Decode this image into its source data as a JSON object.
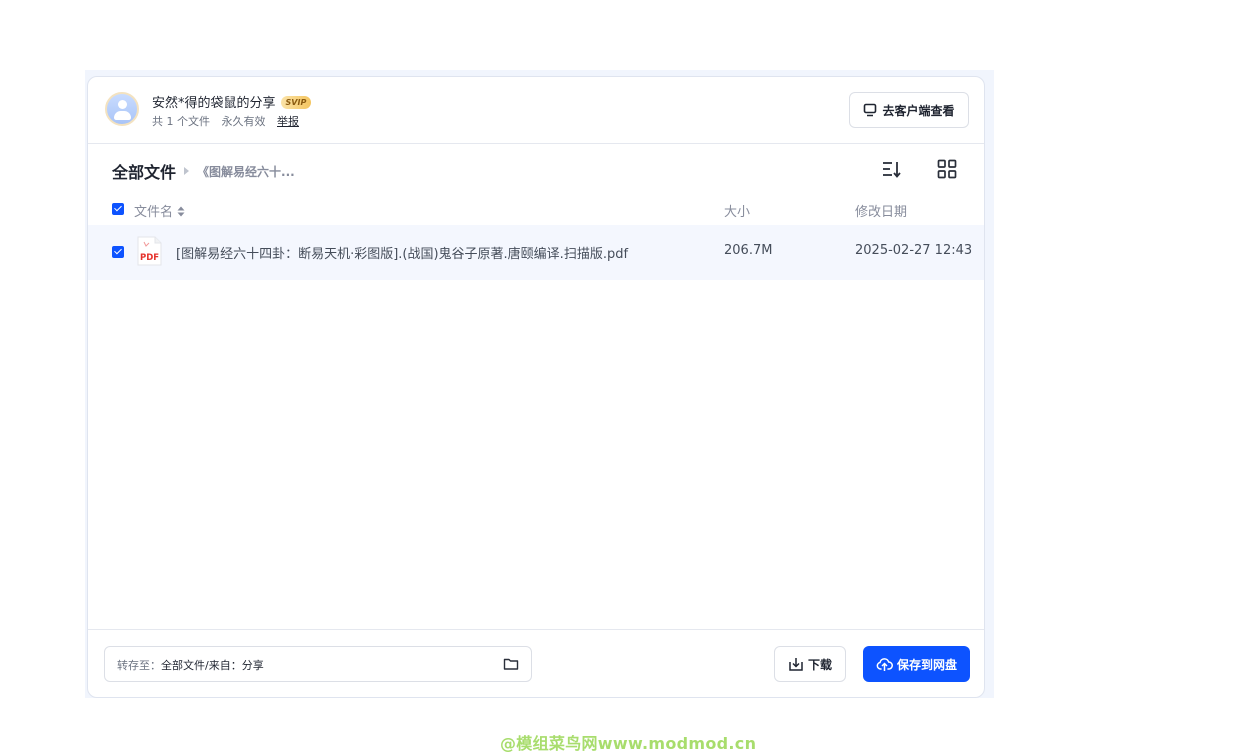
{
  "header": {
    "sharer": "安然*得的袋鼠的分享",
    "badge": "SVIP",
    "file_count": "共 1 个文件",
    "validity": "永久有效",
    "report": "举报",
    "client_button": "去客户端查看"
  },
  "breadcrumb": {
    "root": "全部文件",
    "current": "《图解易经六十..."
  },
  "table": {
    "columns": {
      "name": "文件名",
      "size": "大小",
      "date": "修改日期"
    },
    "rows": [
      {
        "icon": "pdf-file-icon",
        "name": "[图解易经六十四卦：断易天机·彩图版].(战国)鬼谷子原著.唐颐编译.扫描版.pdf",
        "size": "206.7M",
        "date": "2025-02-27 12:43",
        "checked": true
      }
    ]
  },
  "footer": {
    "save_to_label": "转存至：",
    "save_to_value": "全部文件/来自：分享",
    "download_button": "下载",
    "save_button": "保存到网盘"
  },
  "watermark": "@模组菜鸟网www.modmod.cn",
  "colors": {
    "primary": "#0d53ff",
    "row_highlight": "#f4f7fe"
  }
}
